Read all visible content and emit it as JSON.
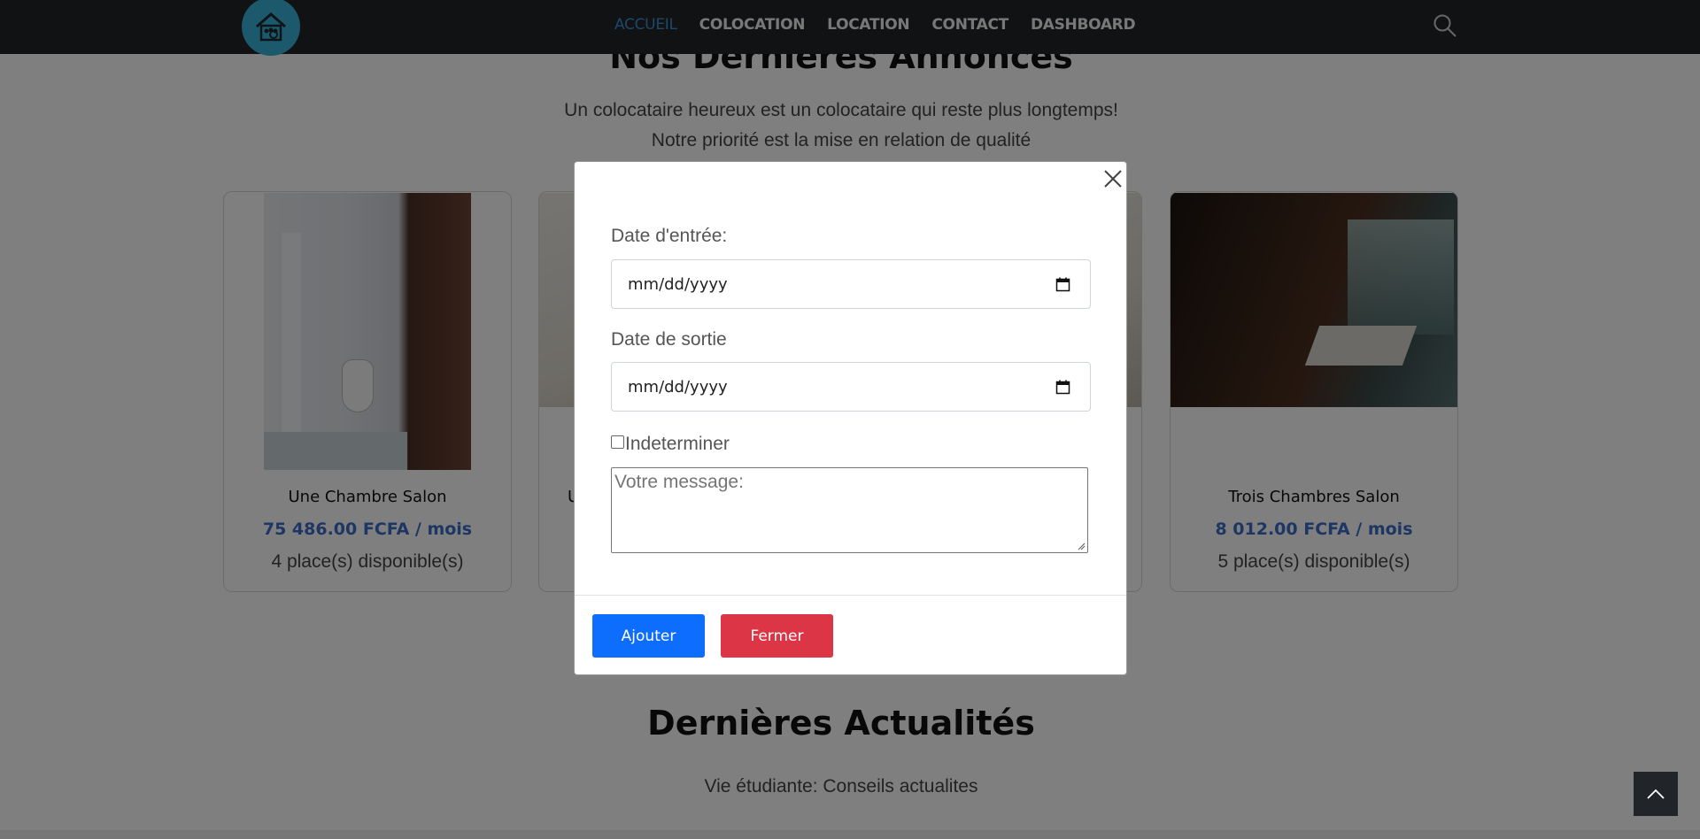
{
  "nav": {
    "items": [
      {
        "label": "ACCUEIL",
        "active": true
      },
      {
        "label": "COLOCATION",
        "active": false
      },
      {
        "label": "LOCATION",
        "active": false
      },
      {
        "label": "CONTACT",
        "active": false
      },
      {
        "label": "DASHBOARD",
        "active": false
      }
    ],
    "logo_icon": "house-people-logo",
    "search_icon": "search-icon"
  },
  "listings_section": {
    "title": "Nos Dernières Annonces",
    "subtitle_line1": "Un colocataire heureux est un colocataire qui reste plus longtemps!",
    "subtitle_line2": "Notre priorité est la mise en relation de qualité"
  },
  "cards": [
    {
      "name": "Une Chambre Salon",
      "price": "75 486.00 FCFA / mois",
      "availability": "4 place(s) disponible(s)"
    },
    {
      "name": "U",
      "price": "",
      "availability": ""
    },
    {
      "name": "",
      "price": "",
      "availability": ""
    },
    {
      "name": "Trois Chambres Salon",
      "price": "8 012.00 FCFA / mois",
      "availability": "5 place(s) disponible(s)"
    }
  ],
  "news_section": {
    "title": "Dernières Actualités",
    "subtitle": "Vie étudiante: Conseils actualites"
  },
  "modal": {
    "entry_date_label": "Date d'entrée:",
    "entry_date_value": "mm/dd/yyyy",
    "exit_date_label": "Date de sortie",
    "exit_date_value": "mm/dd/yyyy",
    "checkbox_label": "Indeterminer",
    "checkbox_checked": false,
    "message_placeholder": "Votre message:",
    "add_button": "Ajouter",
    "close_button": "Fermer"
  },
  "colors": {
    "navbar_bg": "#212529",
    "accent": "#3d8fd0",
    "price": "#3d6cc9",
    "primary_button": "#0d6efd",
    "danger_button": "#dc3545"
  }
}
